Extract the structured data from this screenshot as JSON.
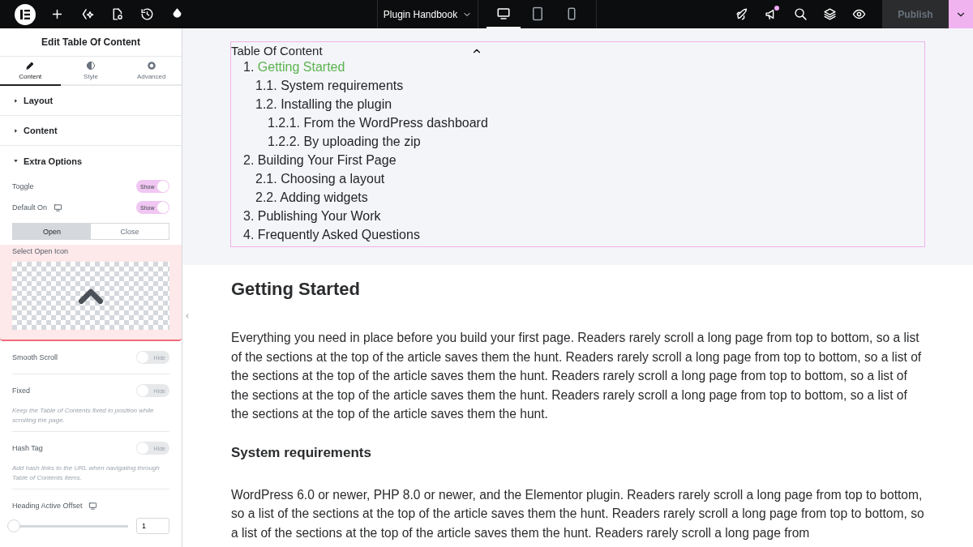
{
  "topbar": {
    "page_title": "Plugin Handbook",
    "devices": [
      {
        "kind": "desktop",
        "selected": true
      },
      {
        "kind": "tablet",
        "selected": false
      },
      {
        "kind": "mobile",
        "selected": false
      }
    ],
    "notification": true,
    "publish": {
      "label": "Publish",
      "disabled": true
    }
  },
  "panel": {
    "title": "Edit Table Of Content",
    "tabs": [
      {
        "label": "Content",
        "selected": true
      },
      {
        "label": "Style",
        "selected": false
      },
      {
        "label": "Advanced",
        "selected": false
      }
    ],
    "sections": [
      {
        "title": "Layout",
        "expanded": false
      },
      {
        "title": "Content",
        "expanded": false
      },
      {
        "title": "Extra Options",
        "expanded": true
      }
    ],
    "controls": [
      {
        "kind": "toggle",
        "label": "Toggle",
        "responsive": false,
        "on": true,
        "state_label": "Show"
      },
      {
        "kind": "toggle",
        "label": "Default On",
        "responsive": true,
        "on": true,
        "state_label": "Show"
      },
      {
        "kind": "segmented",
        "options": [
          {
            "label": "Open",
            "selected": true
          },
          {
            "label": "Close",
            "selected": false
          }
        ]
      },
      {
        "kind": "icon_picker",
        "label": "Select Open Icon",
        "highlighted": true
      },
      {
        "kind": "toggle",
        "label": "Smooth Scroll",
        "responsive": false,
        "on": false,
        "state_label": "Hide"
      },
      {
        "kind": "toggle",
        "label": "Fixed",
        "responsive": false,
        "on": false,
        "state_label": "Hide",
        "description": "Keep the Table of Contents fixed in position while scrolling the page."
      },
      {
        "kind": "toggle",
        "label": "Hash Tag",
        "responsive": false,
        "on": false,
        "state_label": "Hide",
        "description": "Add hash links to the URL when navigating through Table of Contents items."
      },
      {
        "kind": "slider",
        "label": "Heading Active Offset",
        "responsive": true,
        "level": 0,
        "value": "1"
      }
    ]
  },
  "toc": {
    "title": "Table Of Content",
    "expanded": true,
    "items": [
      {
        "number": "1.",
        "text": "Getting Started",
        "active": true,
        "children": [
          {
            "number": "1.1.",
            "text": "System requirements",
            "active": false
          },
          {
            "number": "1.2.",
            "text": "Installing the plugin",
            "active": false,
            "children": [
              {
                "number": "1.2.1.",
                "text": "From the WordPress dashboard",
                "active": false
              },
              {
                "number": "1.2.2.",
                "text": "By uploading the zip",
                "active": false
              }
            ]
          }
        ]
      },
      {
        "number": "2.",
        "text": "Building Your First Page",
        "active": false,
        "children": [
          {
            "number": "2.1.",
            "text": "Choosing a layout",
            "active": false
          },
          {
            "number": "2.2.",
            "text": "Adding widgets",
            "active": false
          }
        ]
      },
      {
        "number": "3.",
        "text": "Publishing Your Work",
        "active": false
      },
      {
        "number": "4.",
        "text": "Frequently Asked Questions",
        "active": false
      }
    ]
  },
  "article": [
    {
      "kind": "heading",
      "text": "Getting Started"
    },
    {
      "kind": "paragraph",
      "text": "Everything you need in place before you build your first page. Readers rarely scroll a long page from top to bottom, so a list of the sections at the top of the article saves them the hunt. Readers rarely scroll a long page from top to bottom, so a list of the sections at the top of the article saves them the hunt. Readers rarely scroll a long page from top to bottom, so a list of the sections at the top of the article saves them the hunt. Readers rarely scroll a long page from top to bottom, so a list of the sections at the top of the article saves them the hunt."
    },
    {
      "kind": "subheading",
      "text": "System requirements"
    },
    {
      "kind": "paragraph",
      "text": "WordPress 6.0 or newer, PHP 8.0 or newer, and the Elementor plugin. Readers rarely scroll a long page from top to bottom, so a list of the sections at the top of the article saves them the hunt. Readers rarely scroll a long page from top to bottom, so a list of the sections at the top of the article saves them the hunt. Readers rarely scroll a long page from"
    }
  ]
}
